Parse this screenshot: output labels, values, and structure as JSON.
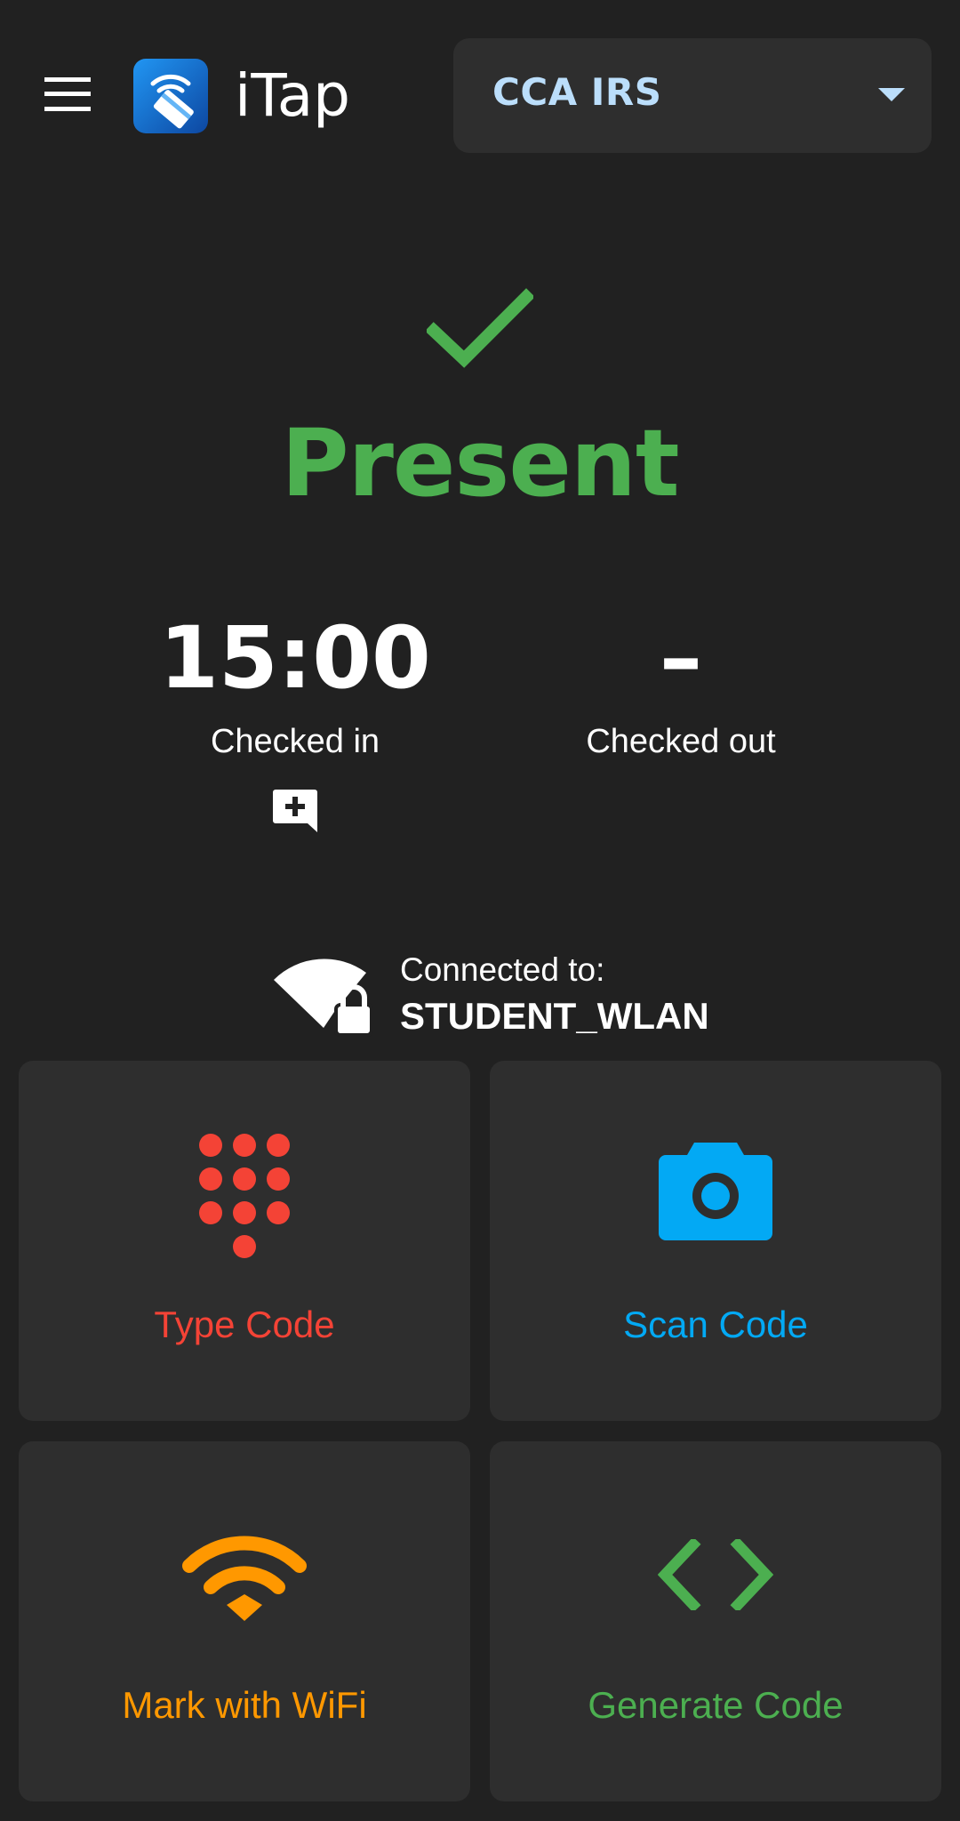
{
  "header": {
    "app_title": "iTap",
    "menu_icon": "hamburger-menu-icon",
    "logo_icon": "itap-logo-icon",
    "course_select": {
      "value": "CCA IRS",
      "icon": "arrow-drop-down-icon"
    }
  },
  "status": {
    "icon": "check-icon",
    "label": "Present",
    "color": "#4caf50"
  },
  "check_in": {
    "time": "15:00",
    "label": "Checked in",
    "comment_icon": "add-comment-icon"
  },
  "check_out": {
    "time": "–",
    "label": "Checked out"
  },
  "connection": {
    "icon": "wifi-lock-icon",
    "label": "Connected to:",
    "ssid": "STUDENT_WLAN"
  },
  "actions": [
    {
      "label": "Type Code",
      "icon": "dialpad-icon",
      "color": "#f44336"
    },
    {
      "label": "Scan Code",
      "icon": "camera-icon",
      "color": "#03a9f4"
    },
    {
      "label": "Mark with WiFi",
      "icon": "wifi-icon",
      "color": "#ff9800"
    },
    {
      "label": "Generate Code",
      "icon": "code-icon",
      "color": "#4caf50"
    }
  ],
  "colors": {
    "background": "#212121",
    "surface": "#2e2e2e",
    "select_text": "#bbdefb",
    "logo_blue": "#1e88e5"
  }
}
